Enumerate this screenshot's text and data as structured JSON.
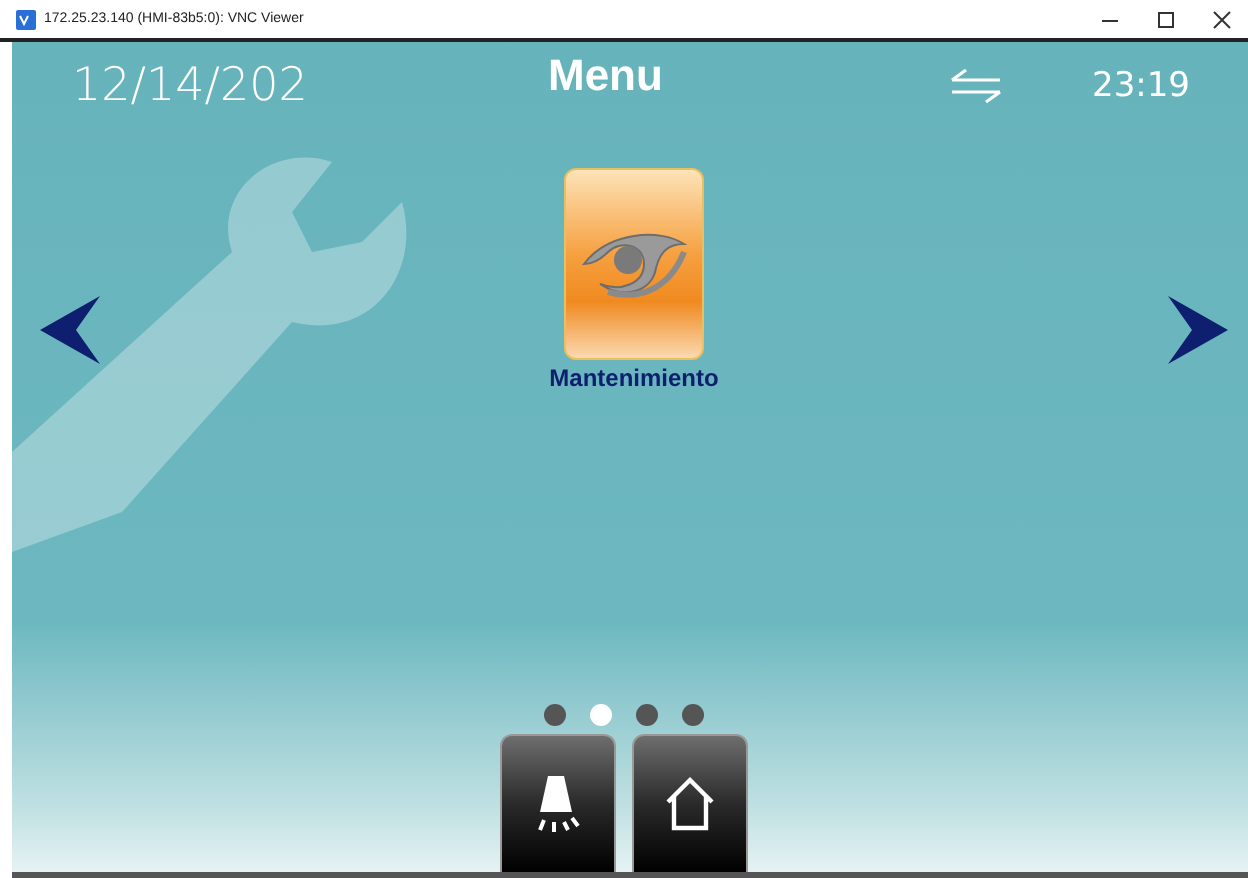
{
  "window": {
    "title": "172.25.23.140 (HMI-83b5:0): VNC Viewer"
  },
  "header": {
    "date": "12/14/202",
    "title": "Menu",
    "time": "23:19"
  },
  "apps": [
    {
      "label": "Mantenimiento"
    }
  ],
  "pages": [
    {
      "selected": false
    },
    {
      "selected": true
    },
    {
      "selected": false
    },
    {
      "selected": false
    }
  ],
  "bottom_buttons": [
    {
      "kind": "alarm"
    },
    {
      "kind": "home"
    }
  ]
}
